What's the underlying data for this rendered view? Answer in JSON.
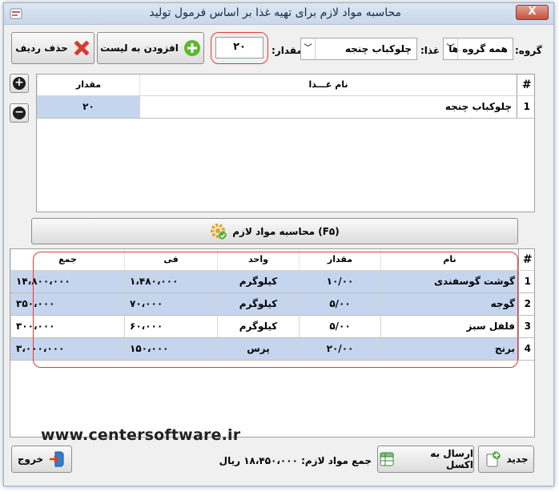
{
  "window": {
    "title": "محاسبه مواد لازم برای تهیه غذا بر اساس فرمول تولید",
    "close_label": "X"
  },
  "toolbar": {
    "group_label": "گروه:",
    "group_value": "همه گروه ها",
    "food_label": "غذا:",
    "food_value": "چلوکباب چنجه",
    "qty_label": "مقدار:",
    "qty_value": "۲۰",
    "add_label": "افزودن به لیست",
    "delete_label": "حذف ردیف"
  },
  "food_grid": {
    "headers": {
      "num": "#",
      "name": "نام غـــذا",
      "qty": "مقدار"
    },
    "rows": [
      {
        "num": "1",
        "name": "چلوکباب چنجه",
        "qty": "۲۰"
      }
    ]
  },
  "calc_button": {
    "label": "(F۵) محاسبه مواد لازم"
  },
  "materials_grid": {
    "headers": {
      "num": "#",
      "name": "نام",
      "qty": "مقدار",
      "unit": "واحد",
      "price": "فی",
      "sum": "جمع"
    },
    "rows": [
      {
        "num": "1",
        "name": "گوشت گوسفندی",
        "qty": "۱۰/۰۰",
        "unit": "کیلوگرم",
        "price": "۱،۴۸۰،۰۰۰",
        "sum": "۱۴،۸۰۰،۰۰۰"
      },
      {
        "num": "2",
        "name": "گوجه",
        "qty": "۵/۰۰",
        "unit": "کیلوگرم",
        "price": "۷۰،۰۰۰",
        "sum": "۳۵۰،۰۰۰"
      },
      {
        "num": "3",
        "name": "فلفل سبز",
        "qty": "۵/۰۰",
        "unit": "کیلوگرم",
        "price": "۶۰،۰۰۰",
        "sum": "۳۰۰،۰۰۰"
      },
      {
        "num": "4",
        "name": "برنج",
        "qty": "۲۰/۰۰",
        "unit": "پرس",
        "price": "۱۵۰،۰۰۰",
        "sum": "۳،۰۰۰،۰۰۰"
      }
    ]
  },
  "footer": {
    "website": "www.centersoftware.ir",
    "new_label": "جدید",
    "excel_label": "ارسال به اکسل",
    "total_text": "جمع مواد لازم: ۱۸،۴۵۰،۰۰۰ ریال",
    "exit_label": "خروج"
  },
  "colors": {
    "accent_selected_row": "#c6d5ee",
    "highlight_red": "#e03a3a",
    "add_icon_green": "#5cb82e",
    "delete_icon_red": "#d93a2b"
  },
  "icons": {
    "add": "plus-circle-icon",
    "delete": "red-x-icon",
    "calc": "gear-check-icon",
    "new": "new-document-icon",
    "excel": "excel-sheet-icon",
    "exit": "exit-door-icon"
  }
}
